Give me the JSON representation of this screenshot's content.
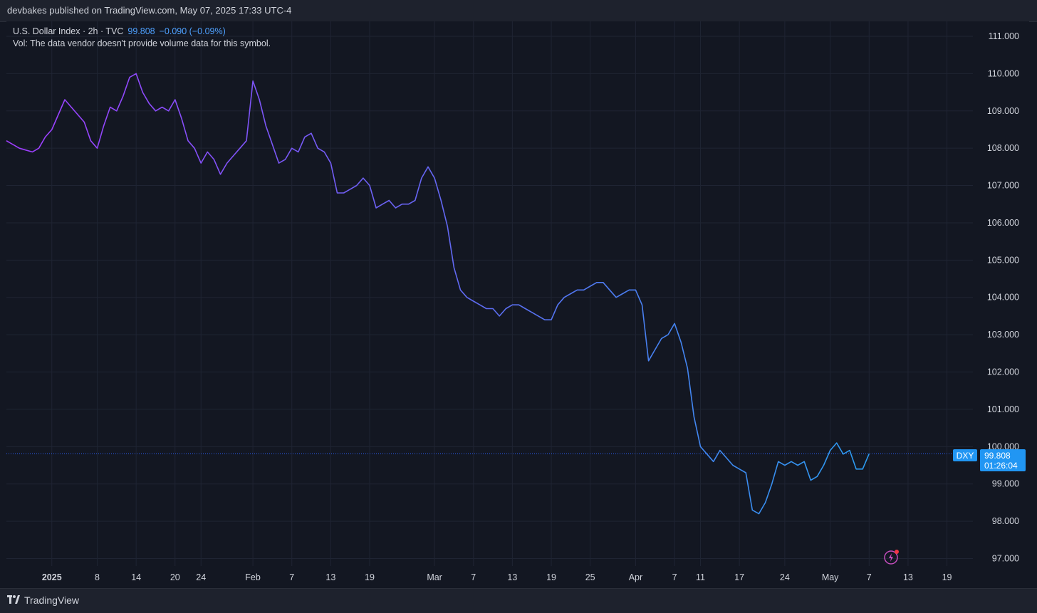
{
  "header": {
    "publisher_line": "devbakes published on TradingView.com, May 07, 2025 17:33 UTC-4"
  },
  "legend": {
    "title": "U.S. Dollar Index · 2h · TVC",
    "last_value": "99.808",
    "change": "−0.090 (−0.09%)",
    "volume_note": "Vol: The data vendor doesn't provide volume data for this symbol."
  },
  "price_tag": {
    "symbol": "DXY",
    "value": "99.808",
    "countdown": "01:26:04"
  },
  "footer": {
    "brand": "TradingView"
  },
  "colors": {
    "background": "#131722",
    "line_start": "#a03dff",
    "line_mid": "#6366f1",
    "line_end": "#2b9bf0",
    "accent": "#2196f3"
  },
  "icons": {
    "alert": "lightning-alert-icon",
    "logo": "tradingview-logo-icon"
  },
  "chart_data": {
    "type": "line",
    "title": "U.S. Dollar Index · 2h · TVC",
    "xlabel": "",
    "ylabel": "",
    "ylim": [
      96.8,
      111.4
    ],
    "y_ticks": [
      "111.000",
      "110.000",
      "109.000",
      "108.000",
      "107.000",
      "106.000",
      "105.000",
      "104.000",
      "103.000",
      "102.000",
      "101.000",
      "100.000",
      "99.000",
      "98.000",
      "97.000"
    ],
    "x_ticks": [
      {
        "label": "2025",
        "date": "2025-01-01",
        "bold": true
      },
      {
        "label": "8",
        "date": "2025-01-08"
      },
      {
        "label": "14",
        "date": "2025-01-14"
      },
      {
        "label": "20",
        "date": "2025-01-20"
      },
      {
        "label": "24",
        "date": "2025-01-24"
      },
      {
        "label": "Feb",
        "date": "2025-02-01"
      },
      {
        "label": "7",
        "date": "2025-02-07"
      },
      {
        "label": "13",
        "date": "2025-02-13"
      },
      {
        "label": "19",
        "date": "2025-02-19"
      },
      {
        "label": "Mar",
        "date": "2025-03-01"
      },
      {
        "label": "7",
        "date": "2025-03-07"
      },
      {
        "label": "13",
        "date": "2025-03-13"
      },
      {
        "label": "19",
        "date": "2025-03-19"
      },
      {
        "label": "25",
        "date": "2025-03-25"
      },
      {
        "label": "Apr",
        "date": "2025-04-01"
      },
      {
        "label": "7",
        "date": "2025-04-07"
      },
      {
        "label": "11",
        "date": "2025-04-11"
      },
      {
        "label": "17",
        "date": "2025-04-17"
      },
      {
        "label": "24",
        "date": "2025-04-24"
      },
      {
        "label": "May",
        "date": "2025-05-01"
      },
      {
        "label": "7",
        "date": "2025-05-07"
      },
      {
        "label": "13",
        "date": "2025-05-13"
      },
      {
        "label": "19",
        "date": "2025-05-19"
      }
    ],
    "current_price": 99.808,
    "series": [
      {
        "points": [
          [
            "2024-12-25",
            108.2
          ],
          [
            "2024-12-26",
            108.1
          ],
          [
            "2024-12-27",
            108.0
          ],
          [
            "2024-12-28",
            107.95
          ],
          [
            "2024-12-29",
            107.9
          ],
          [
            "2024-12-30",
            108.0
          ],
          [
            "2024-12-31",
            108.3
          ],
          [
            "2025-01-01",
            108.5
          ],
          [
            "2025-01-02",
            108.9
          ],
          [
            "2025-01-03",
            109.3
          ],
          [
            "2025-01-04",
            109.1
          ],
          [
            "2025-01-05",
            108.9
          ],
          [
            "2025-01-06",
            108.7
          ],
          [
            "2025-01-07",
            108.2
          ],
          [
            "2025-01-08",
            108.0
          ],
          [
            "2025-01-09",
            108.6
          ],
          [
            "2025-01-10",
            109.1
          ],
          [
            "2025-01-11",
            109.0
          ],
          [
            "2025-01-12",
            109.4
          ],
          [
            "2025-01-13",
            109.9
          ],
          [
            "2025-01-14",
            110.0
          ],
          [
            "2025-01-15",
            109.5
          ],
          [
            "2025-01-16",
            109.2
          ],
          [
            "2025-01-17",
            109.0
          ],
          [
            "2025-01-18",
            109.1
          ],
          [
            "2025-01-19",
            109.0
          ],
          [
            "2025-01-20",
            109.3
          ],
          [
            "2025-01-21",
            108.8
          ],
          [
            "2025-01-22",
            108.2
          ],
          [
            "2025-01-23",
            108.0
          ],
          [
            "2025-01-24",
            107.6
          ],
          [
            "2025-01-25",
            107.9
          ],
          [
            "2025-01-26",
            107.7
          ],
          [
            "2025-01-27",
            107.3
          ],
          [
            "2025-01-28",
            107.6
          ],
          [
            "2025-01-29",
            107.8
          ],
          [
            "2025-01-30",
            108.0
          ],
          [
            "2025-01-31",
            108.2
          ],
          [
            "2025-02-01",
            109.8
          ],
          [
            "2025-02-02",
            109.3
          ],
          [
            "2025-02-03",
            108.6
          ],
          [
            "2025-02-04",
            108.1
          ],
          [
            "2025-02-05",
            107.6
          ],
          [
            "2025-02-06",
            107.7
          ],
          [
            "2025-02-07",
            108.0
          ],
          [
            "2025-02-08",
            107.9
          ],
          [
            "2025-02-09",
            108.3
          ],
          [
            "2025-02-10",
            108.4
          ],
          [
            "2025-02-11",
            108.0
          ],
          [
            "2025-02-12",
            107.9
          ],
          [
            "2025-02-13",
            107.6
          ],
          [
            "2025-02-14",
            106.8
          ],
          [
            "2025-02-15",
            106.8
          ],
          [
            "2025-02-16",
            106.9
          ],
          [
            "2025-02-17",
            107.0
          ],
          [
            "2025-02-18",
            107.2
          ],
          [
            "2025-02-19",
            107.0
          ],
          [
            "2025-02-20",
            106.4
          ],
          [
            "2025-02-21",
            106.5
          ],
          [
            "2025-02-22",
            106.6
          ],
          [
            "2025-02-23",
            106.4
          ],
          [
            "2025-02-24",
            106.5
          ],
          [
            "2025-02-25",
            106.5
          ],
          [
            "2025-02-26",
            106.6
          ],
          [
            "2025-02-27",
            107.2
          ],
          [
            "2025-02-28",
            107.5
          ],
          [
            "2025-03-01",
            107.2
          ],
          [
            "2025-03-02",
            106.6
          ],
          [
            "2025-03-03",
            105.9
          ],
          [
            "2025-03-04",
            104.8
          ],
          [
            "2025-03-05",
            104.2
          ],
          [
            "2025-03-06",
            104.0
          ],
          [
            "2025-03-07",
            103.9
          ],
          [
            "2025-03-08",
            103.8
          ],
          [
            "2025-03-09",
            103.7
          ],
          [
            "2025-03-10",
            103.7
          ],
          [
            "2025-03-11",
            103.5
          ],
          [
            "2025-03-12",
            103.7
          ],
          [
            "2025-03-13",
            103.8
          ],
          [
            "2025-03-14",
            103.8
          ],
          [
            "2025-03-15",
            103.7
          ],
          [
            "2025-03-16",
            103.6
          ],
          [
            "2025-03-17",
            103.5
          ],
          [
            "2025-03-18",
            103.4
          ],
          [
            "2025-03-19",
            103.4
          ],
          [
            "2025-03-20",
            103.8
          ],
          [
            "2025-03-21",
            104.0
          ],
          [
            "2025-03-22",
            104.1
          ],
          [
            "2025-03-23",
            104.2
          ],
          [
            "2025-03-24",
            104.2
          ],
          [
            "2025-03-25",
            104.3
          ],
          [
            "2025-03-26",
            104.4
          ],
          [
            "2025-03-27",
            104.4
          ],
          [
            "2025-03-28",
            104.2
          ],
          [
            "2025-03-29",
            104.0
          ],
          [
            "2025-03-30",
            104.1
          ],
          [
            "2025-03-31",
            104.2
          ],
          [
            "2025-04-01",
            104.2
          ],
          [
            "2025-04-02",
            103.8
          ],
          [
            "2025-04-03",
            102.3
          ],
          [
            "2025-04-04",
            102.6
          ],
          [
            "2025-04-05",
            102.9
          ],
          [
            "2025-04-06",
            103.0
          ],
          [
            "2025-04-07",
            103.3
          ],
          [
            "2025-04-08",
            102.8
          ],
          [
            "2025-04-09",
            102.1
          ],
          [
            "2025-04-10",
            100.8
          ],
          [
            "2025-04-11",
            100.0
          ],
          [
            "2025-04-12",
            99.8
          ],
          [
            "2025-04-13",
            99.6
          ],
          [
            "2025-04-14",
            99.9
          ],
          [
            "2025-04-15",
            99.7
          ],
          [
            "2025-04-16",
            99.5
          ],
          [
            "2025-04-17",
            99.4
          ],
          [
            "2025-04-18",
            99.3
          ],
          [
            "2025-04-19",
            98.3
          ],
          [
            "2025-04-20",
            98.2
          ],
          [
            "2025-04-21",
            98.5
          ],
          [
            "2025-04-22",
            99.0
          ],
          [
            "2025-04-23",
            99.6
          ],
          [
            "2025-04-24",
            99.5
          ],
          [
            "2025-04-25",
            99.6
          ],
          [
            "2025-04-26",
            99.5
          ],
          [
            "2025-04-27",
            99.6
          ],
          [
            "2025-04-28",
            99.1
          ],
          [
            "2025-04-29",
            99.2
          ],
          [
            "2025-04-30",
            99.5
          ],
          [
            "2025-05-01",
            99.9
          ],
          [
            "2025-05-02",
            100.1
          ],
          [
            "2025-05-03",
            99.8
          ],
          [
            "2025-05-04",
            99.9
          ],
          [
            "2025-05-05",
            99.4
          ],
          [
            "2025-05-06",
            99.4
          ],
          [
            "2025-05-07",
            99.81
          ]
        ]
      }
    ]
  }
}
